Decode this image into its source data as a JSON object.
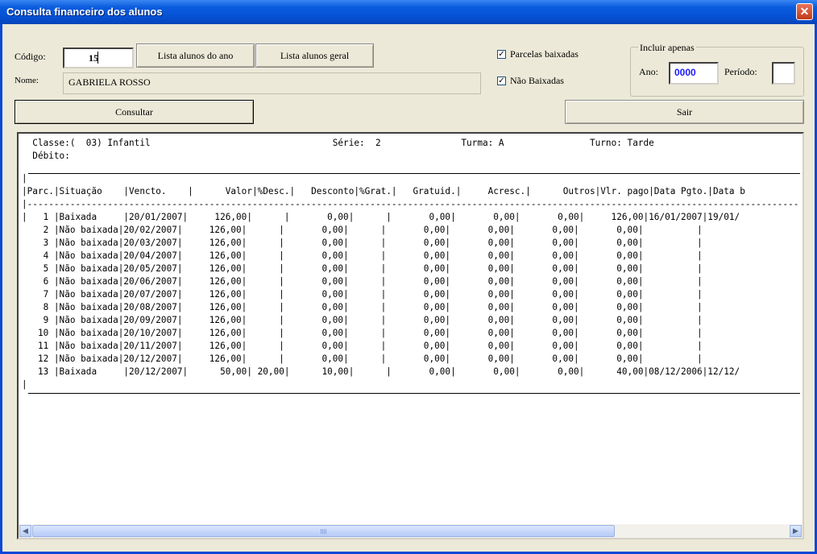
{
  "window": {
    "title": "Consulta financeiro dos alunos"
  },
  "form": {
    "codigo_label": "Código:",
    "codigo_value": "15",
    "nome_label": "Nome:",
    "nome_value": "GABRIELA ROSSO",
    "btn_lista_ano": "Lista alunos do ano",
    "btn_lista_geral": "Lista alunos geral",
    "btn_consultar": "Consultar",
    "btn_sair": "Sair",
    "chk_baixadas_label": "Parcelas baixadas",
    "chk_baixadas_checked": true,
    "chk_nao_baixadas_label": "Não Baixadas",
    "chk_nao_baixadas_checked": true,
    "incluir_label": "Incluir apenas",
    "ano_label": "Ano:",
    "ano_value": "0000",
    "periodo_label": "Período:",
    "periodo_value": ""
  },
  "report": {
    "lines": [
      "  Classe:(  03) Infantil                                  Série:  2               Turma: A                Turno: Tarde",
      "  Débito:",
      "",
      "",
      "|",
      "|Parc.|Situação    |Vencto.    |      Valor|%Desc.|   Desconto|%Grat.|   Gratuid.|     Acresc.|      Outros|Vlr. pago|Data Pgto.|Data b",
      "|-------------------------------------------------------------------------------------------------------------------------------------------------",
      "|   1 |Baixada     |20/01/2007|     126,00|      |       0,00|      |       0,00|       0,00|       0,00|     126,00|16/01/2007|19/01/",
      "    2 |Não baixada|20/02/2007|     126,00|      |       0,00|      |       0,00|       0,00|       0,00|       0,00|          |",
      "    3 |Não baixada|20/03/2007|     126,00|      |       0,00|      |       0,00|       0,00|       0,00|       0,00|          |",
      "    4 |Não baixada|20/04/2007|     126,00|      |       0,00|      |       0,00|       0,00|       0,00|       0,00|          |",
      "    5 |Não baixada|20/05/2007|     126,00|      |       0,00|      |       0,00|       0,00|       0,00|       0,00|          |",
      "    6 |Não baixada|20/06/2007|     126,00|      |       0,00|      |       0,00|       0,00|       0,00|       0,00|          |",
      "    7 |Não baixada|20/07/2007|     126,00|      |       0,00|      |       0,00|       0,00|       0,00|       0,00|          |",
      "    8 |Não baixada|20/08/2007|     126,00|      |       0,00|      |       0,00|       0,00|       0,00|       0,00|          |",
      "    9 |Não baixada|20/09/2007|     126,00|      |       0,00|      |       0,00|       0,00|       0,00|       0,00|          |",
      "   10 |Não baixada|20/10/2007|     126,00|      |       0,00|      |       0,00|       0,00|       0,00|       0,00|          |",
      "   11 |Não baixada|20/11/2007|     126,00|      |       0,00|      |       0,00|       0,00|       0,00|       0,00|          |",
      "   12 |Não baixada|20/12/2007|     126,00|      |       0,00|      |       0,00|       0,00|       0,00|       0,00|          |",
      "   13 |Baixada     |20/12/2007|      50,00| 20,00|      10,00|      |       0,00|       0,00|       0,00|      40,00|08/12/2006|12/12/",
      "|"
    ]
  },
  "scrollbar": {
    "left_arrow": "◀",
    "right_arrow": "▶"
  }
}
